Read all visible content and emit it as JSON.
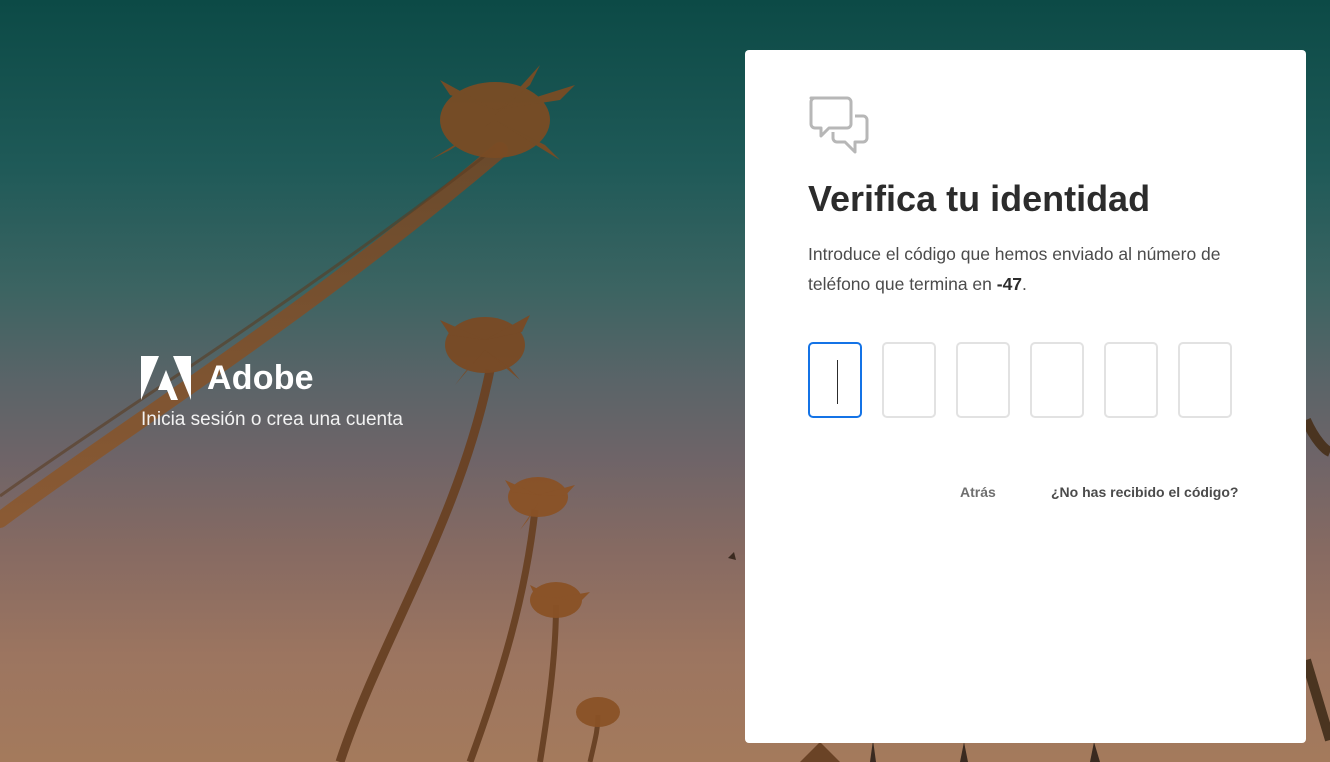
{
  "brand": {
    "name": "Adobe",
    "tagline": "Inicia sesión o crea una cuenta"
  },
  "card": {
    "icon": "chat-bubbles-icon",
    "title": "Verifica tu identidad",
    "description_prefix": "Introduce el código que hemos enviado al número de teléfono que termina en ",
    "phone_suffix": "-47",
    "description_suffix": ".",
    "code_digits": [
      "",
      "",
      "",
      "",
      "",
      ""
    ],
    "active_digit_index": 0,
    "links": {
      "back_label": "Atrás",
      "resend_label": "¿No has recibido el código?"
    }
  },
  "colors": {
    "accent": "#1473e6",
    "title": "#2c2c2c",
    "body_text": "#4b4b4b"
  }
}
